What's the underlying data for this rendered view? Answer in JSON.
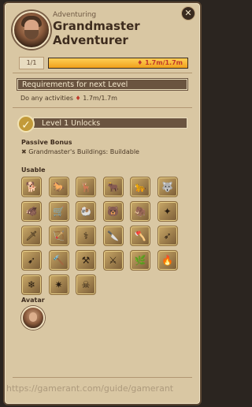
{
  "header": {
    "subtitle": "Adventuring",
    "title": "Grandmaster Adventurer",
    "close_label": "✕"
  },
  "level": {
    "current": "1/1",
    "progress_text": "1.7m/1.7m",
    "progress_fraction": 1.0
  },
  "requirements": {
    "heading": "Requirements for next Level",
    "text_prefix": "Do any activities",
    "gem_icon": "gem-icon",
    "value": "1.7m/1.7m"
  },
  "unlocks": {
    "heading": "Level 1 Unlocks",
    "passive_bonus_title": "Passive Bonus",
    "passive_bonus_item": "Grandmaster's Buildings: Buildable",
    "usable_title": "Usable",
    "usable_items": [
      {
        "icon": "dog-mount-icon",
        "glyph": "🐕"
      },
      {
        "icon": "horse-mount-icon",
        "glyph": "🐎"
      },
      {
        "icon": "stag-mount-icon",
        "glyph": "🦌"
      },
      {
        "icon": "ox-mount-icon",
        "glyph": "🐂"
      },
      {
        "icon": "swiftclaw-mount-icon",
        "glyph": "🐆"
      },
      {
        "icon": "direwolf-mount-icon",
        "glyph": "🐺"
      },
      {
        "icon": "boar-mount-icon",
        "glyph": "🐗"
      },
      {
        "icon": "wagon-mount-icon",
        "glyph": "🛒"
      },
      {
        "icon": "ram-mount-icon",
        "glyph": "🐏"
      },
      {
        "icon": "bear-mount-icon",
        "glyph": "🐻"
      },
      {
        "icon": "mammoth-mount-icon",
        "glyph": "🦣"
      },
      {
        "icon": "gear-bundle-icon",
        "glyph": "✦"
      },
      {
        "icon": "sword-icon",
        "glyph": "🗡"
      },
      {
        "icon": "bow-icon",
        "glyph": "🏹"
      },
      {
        "icon": "staff-icon",
        "glyph": "⚕"
      },
      {
        "icon": "dagger-icon",
        "glyph": "🔪"
      },
      {
        "icon": "axe-icon",
        "glyph": "🪓"
      },
      {
        "icon": "crossbow-icon",
        "glyph": "➶"
      },
      {
        "icon": "spear-icon",
        "glyph": "➹"
      },
      {
        "icon": "hammer-icon",
        "glyph": "🔨"
      },
      {
        "icon": "mace-icon",
        "glyph": "⚒"
      },
      {
        "icon": "quarterstaff-icon",
        "glyph": "⚔"
      },
      {
        "icon": "nature-staff-icon",
        "glyph": "🌿"
      },
      {
        "icon": "fire-staff-icon",
        "glyph": "🔥"
      },
      {
        "icon": "frost-staff-icon",
        "glyph": "❄"
      },
      {
        "icon": "arcane-staff-icon",
        "glyph": "✷"
      },
      {
        "icon": "curse-staff-icon",
        "glyph": "☠"
      }
    ],
    "avatar_title": "Avatar"
  },
  "watermark": "https://gamerant.com/guide/gamerant"
}
